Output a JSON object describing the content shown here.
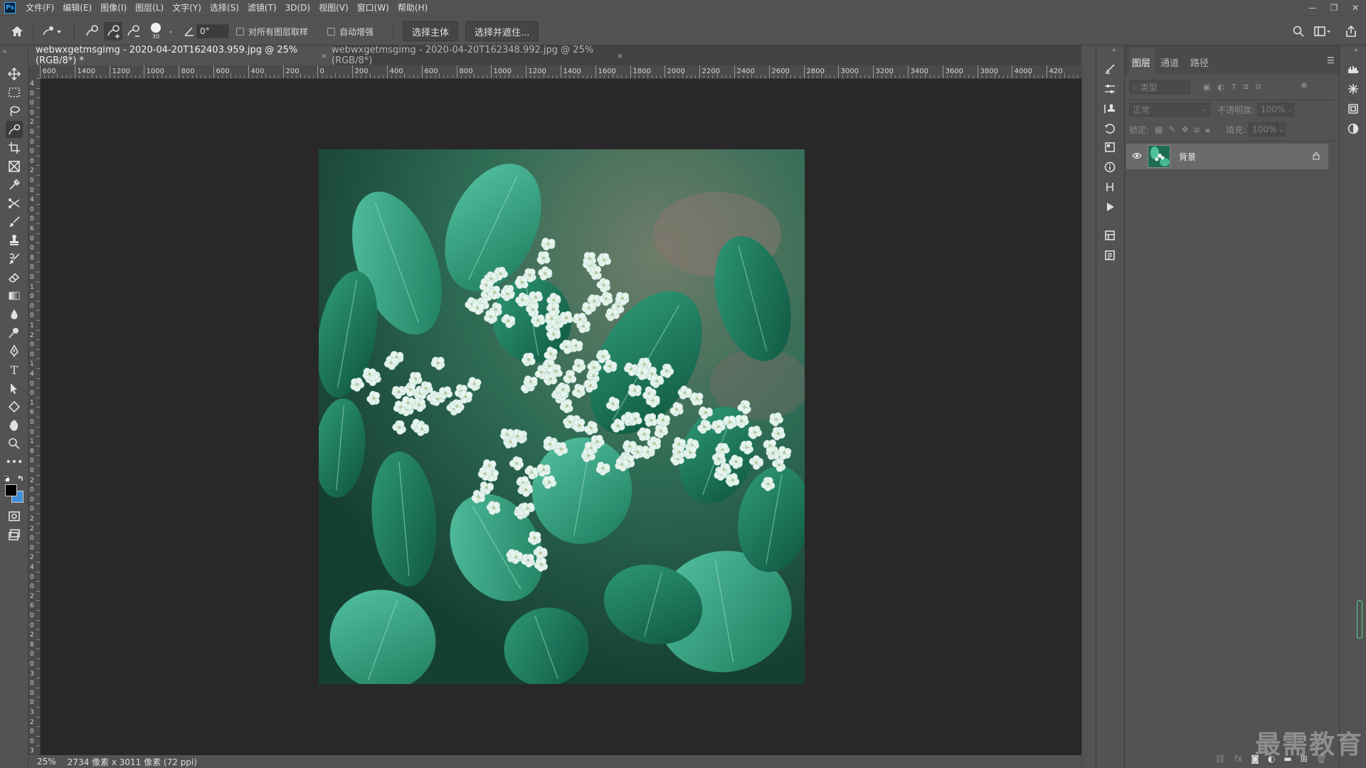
{
  "app": {
    "logo_text": "Ps"
  },
  "menu": [
    "文件(F)",
    "编辑(E)",
    "图像(I)",
    "图层(L)",
    "文字(Y)",
    "选择(S)",
    "滤镜(T)",
    "3D(D)",
    "视图(V)",
    "窗口(W)",
    "帮助(H)"
  ],
  "window_controls": {
    "minimize": "—",
    "restore": "❐",
    "close": "✕"
  },
  "options_bar": {
    "brush_size": "30",
    "angle_value": "0°",
    "sample_all_layers_label": "对所有图层取样",
    "auto_enhance_label": "自动增强",
    "select_subject_label": "选择主体",
    "select_and_mask_label": "选择并遮住..."
  },
  "tabs": [
    {
      "label": "webwxgetmsgimg - 2020-04-20T162403.959.jpg @ 25%(RGB/8*) *",
      "close": "×"
    },
    {
      "label": "webwxgetmsgimg - 2020-04-20T162348.992.jpg @ 25%(RGB/8*)",
      "close": "×"
    }
  ],
  "ruler_h": [
    "600",
    "1400",
    "1200",
    "1000",
    "800",
    "600",
    "400",
    "200",
    "0",
    "200",
    "400",
    "600",
    "800",
    "1000",
    "1200",
    "1400",
    "1600",
    "1800",
    "2000",
    "2200",
    "2400",
    "2600",
    "2800",
    "3000",
    "3200",
    "3400",
    "3600",
    "3800",
    "4000",
    "420"
  ],
  "ruler_v": [
    "4",
    "0",
    "0",
    "0",
    "2",
    "0",
    "0",
    "0",
    "0",
    "2",
    "0",
    "0",
    "4",
    "0",
    "0",
    "6",
    "0",
    "0",
    "8",
    "0",
    "0",
    "1",
    "0",
    "0",
    "0",
    "1",
    "2",
    "0",
    "0",
    "1",
    "4",
    "0",
    "0",
    "1",
    "6",
    "0",
    "0",
    "1",
    "8",
    "0",
    "0",
    "2",
    "0",
    "0",
    "0",
    "2",
    "2",
    "0",
    "0",
    "2",
    "4",
    "0",
    "0",
    "2",
    "6",
    "0",
    "0",
    "2",
    "8",
    "0",
    "0",
    "3",
    "0",
    "0",
    "0",
    "3",
    "2",
    "0",
    "0",
    "3"
  ],
  "status": {
    "zoom": "25%",
    "doc_info": "2734 像素 x 3011 像素 (72 ppi)"
  },
  "layers_panel": {
    "tabs": [
      "图层",
      "通道",
      "路径"
    ],
    "filter_placeholder": "类型",
    "blend_mode": "正常",
    "opacity_label": "不透明度:",
    "opacity_value": "100%",
    "lock_label": "锁定:",
    "fill_label": "填充:",
    "fill_value": "100%",
    "layers": [
      {
        "name": "背景",
        "visible": true,
        "locked": true
      }
    ]
  },
  "watermark": "最需教育",
  "colors": {
    "accent": "#31a8ff",
    "panel_bg": "#535353",
    "canvas_bg": "#282828",
    "foreground": "#000000",
    "background": "#3d8fd6"
  }
}
